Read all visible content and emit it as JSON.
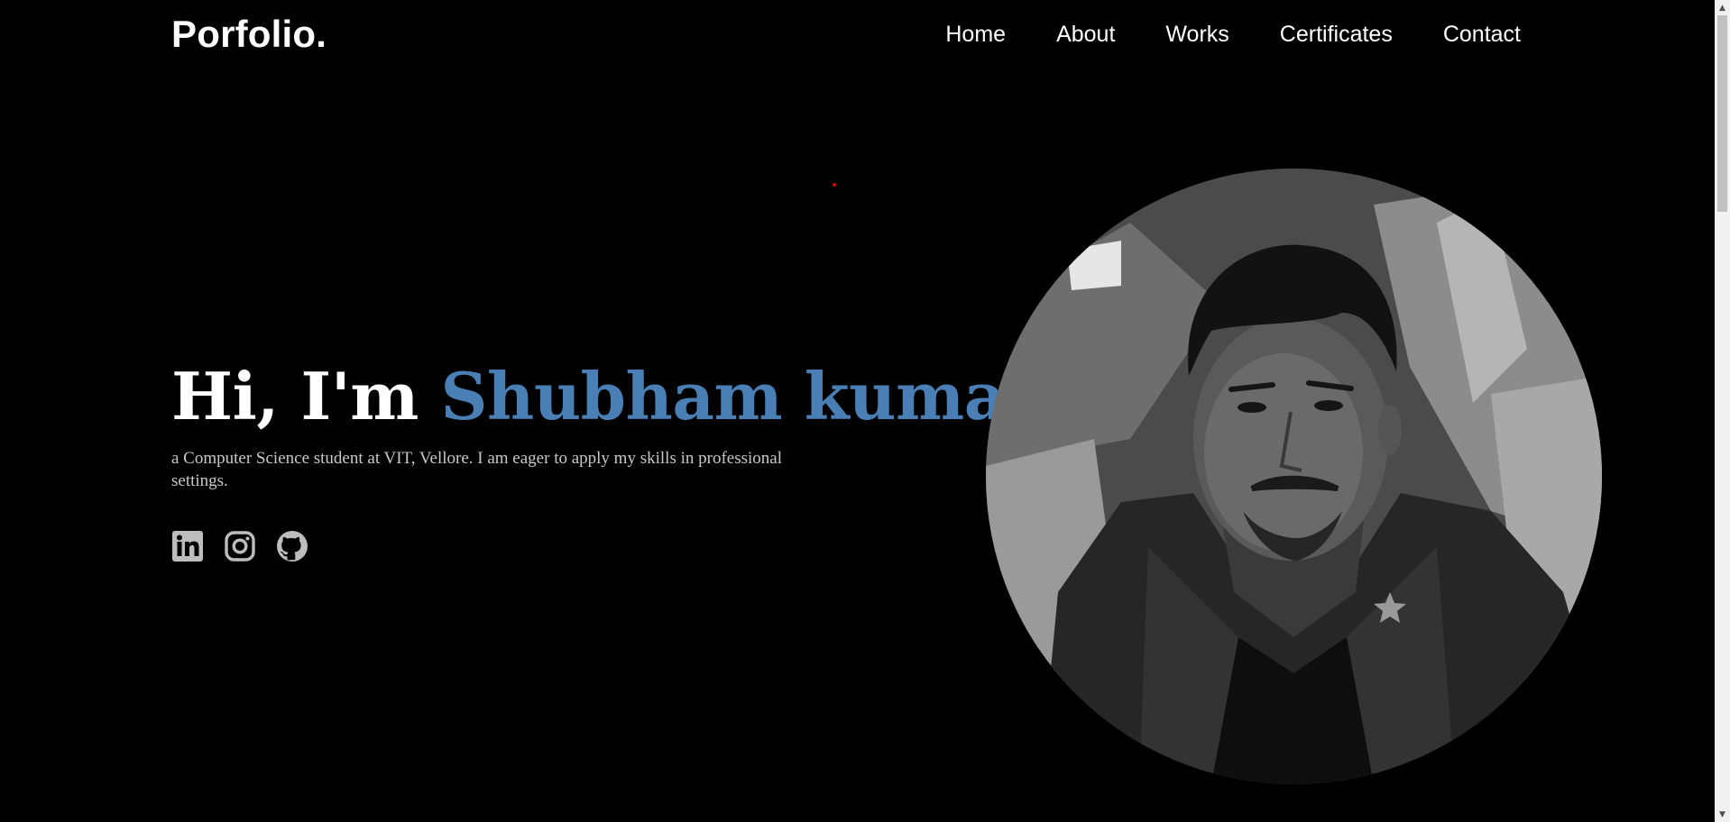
{
  "header": {
    "logo": "Porfolio.",
    "nav": [
      {
        "label": "Home"
      },
      {
        "label": "About"
      },
      {
        "label": "Works"
      },
      {
        "label": "Certificates"
      },
      {
        "label": "Contact"
      }
    ]
  },
  "hero": {
    "greeting": "Hi, I'm ",
    "name": "Shubham kumar",
    "comma": ",",
    "subtitle": "a Computer Science student at VIT, Vellore. I am eager to apply my skills in professional settings.",
    "socials": [
      {
        "icon": "linkedin-icon"
      },
      {
        "icon": "instagram-icon"
      },
      {
        "icon": "github-icon"
      }
    ],
    "portrait_icon": "portrait-photo"
  },
  "colors": {
    "background": "#000000",
    "accent": "#4a7fb5",
    "text": "#ffffff",
    "subtitle": "#c8c8c8",
    "icon": "#bdbdbd",
    "dot": "#d40000"
  },
  "scrollbar": {
    "up_arrow": "▲",
    "down_arrow": "▼"
  }
}
